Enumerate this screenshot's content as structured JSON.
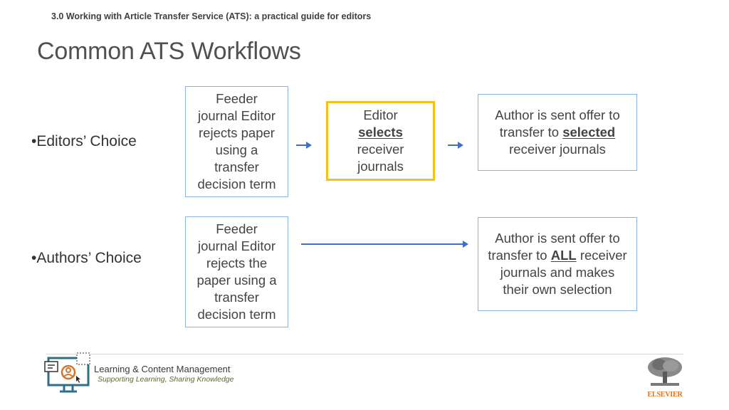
{
  "header": {
    "subtitle": "3.0 Working with Article Transfer Service (ATS): a practical guide for editors",
    "title": "Common ATS Workflows"
  },
  "rows": [
    {
      "label": "•Editors’ Choice",
      "boxes": [
        {
          "lines": [
            "Feeder",
            "journal Editor",
            "rejects paper",
            "using a",
            "transfer",
            "decision term"
          ]
        },
        {
          "pre": "Editor",
          "emphasis": "selects",
          "post": "receiver journals",
          "highlight_color": "#f5c018"
        },
        {
          "pre": "Author is sent offer to transfer to",
          "emphasis": "selected",
          "post": "receiver journals"
        }
      ]
    },
    {
      "label": "•Authors’ Choice",
      "boxes": [
        {
          "lines": [
            "Feeder",
            "journal Editor",
            "rejects the",
            "paper using a",
            "transfer",
            "decision term"
          ]
        },
        {
          "pre": "Author is sent offer to transfer to",
          "emphasis": "ALL",
          "post": "receiver journals and makes their own selection"
        }
      ]
    }
  ],
  "footer": {
    "logo_title": "Learning & Content Management",
    "logo_tagline": "Supporting Learning, Sharing Knowledge",
    "publisher": "ELSEVIER"
  },
  "colors": {
    "box_border": "#8eb2e0",
    "highlight_border": "#f5c018",
    "arrow": "#3a72c8",
    "publisher_orange": "#e3701a"
  }
}
